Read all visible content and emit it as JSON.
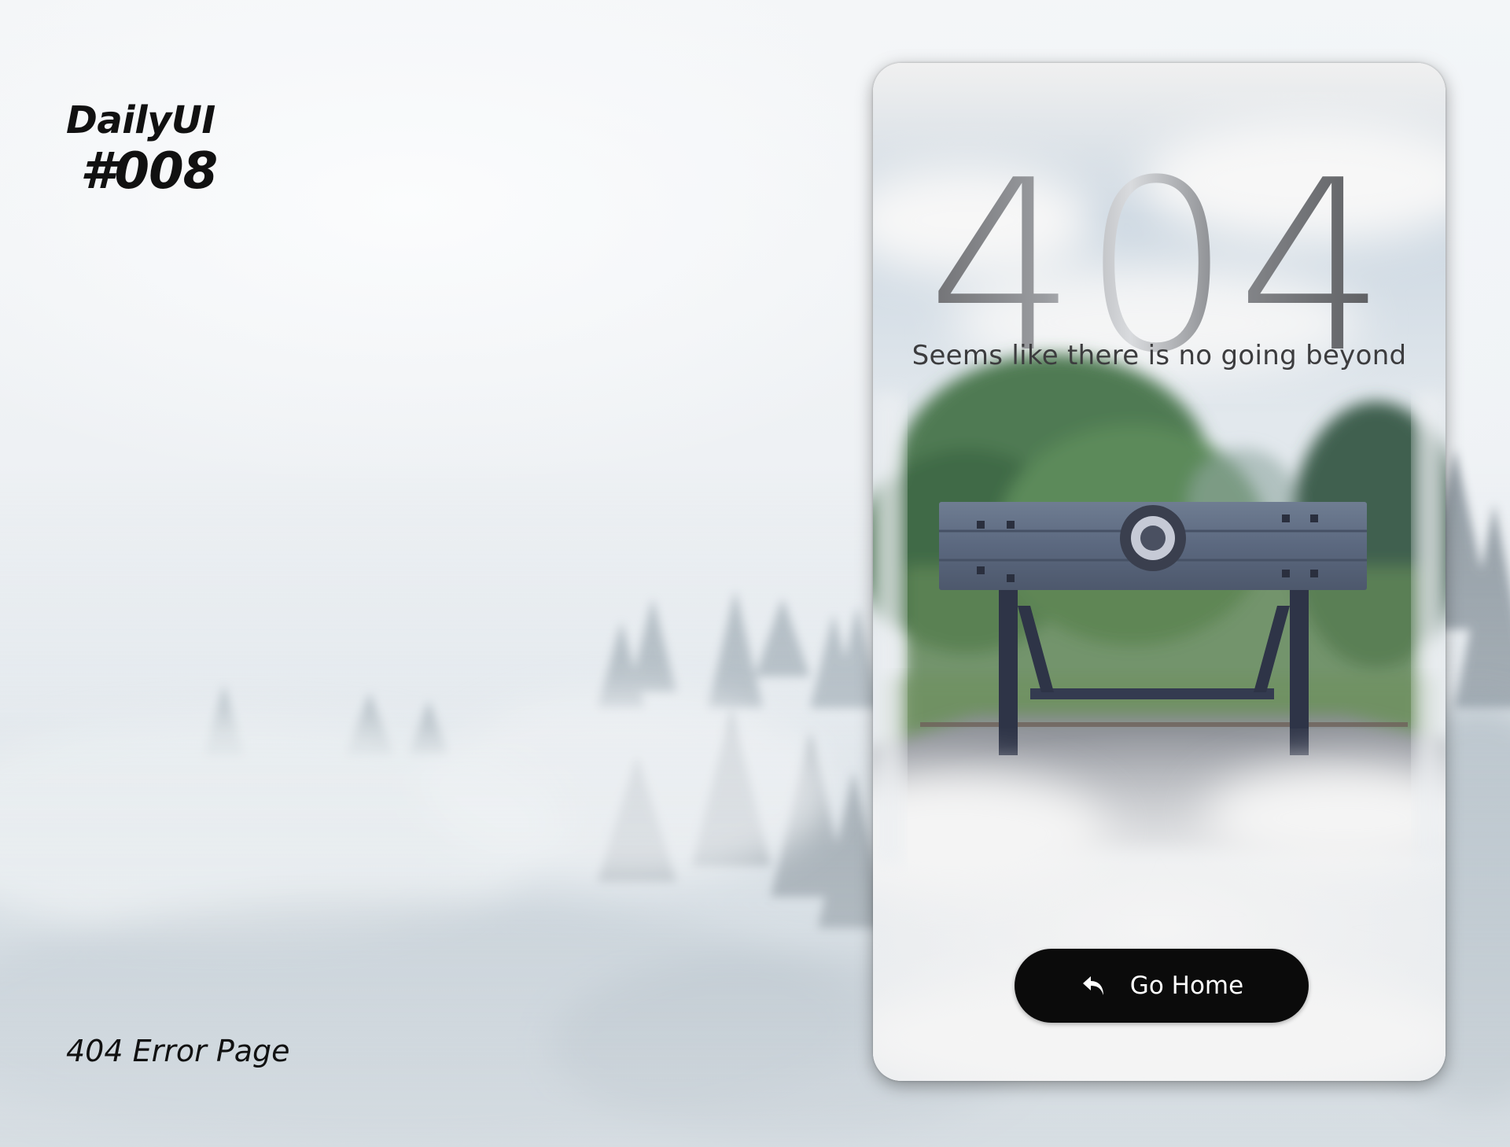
{
  "brand": {
    "title": "DailyUI",
    "number": "#008"
  },
  "caption": "404 Error Page",
  "error_card": {
    "code": "404",
    "message": "Seems like there is no going beyond",
    "home_button": {
      "label": "Go Home",
      "icon": "return-arrow-icon"
    }
  },
  "colors": {
    "button_bg": "#0b0b0b",
    "button_text": "#ffffff",
    "text_dark": "#111111"
  }
}
